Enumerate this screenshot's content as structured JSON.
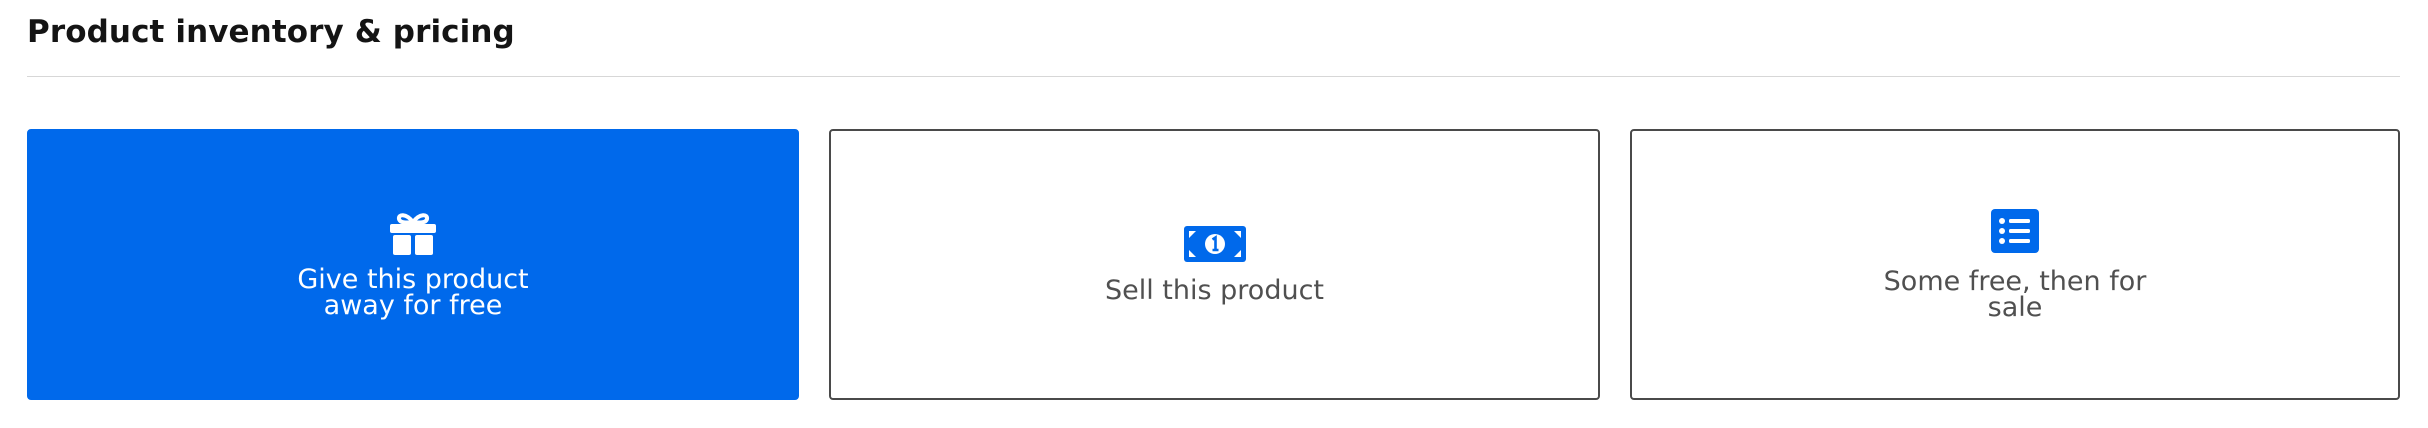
{
  "section": {
    "title": "Product inventory & pricing"
  },
  "options": [
    {
      "label": "Give this product away for free",
      "icon": "gift-icon",
      "selected": true
    },
    {
      "label": "Sell this product",
      "icon": "dollar-bill-icon",
      "selected": false
    },
    {
      "label": "Some free, then for sale",
      "icon": "list-icon",
      "selected": false
    }
  ],
  "colors": {
    "accent": "#0069eb",
    "border": "#4a4a4a",
    "divider": "#d7d7d7",
    "text_dark": "#141414",
    "text_muted": "#505050"
  }
}
